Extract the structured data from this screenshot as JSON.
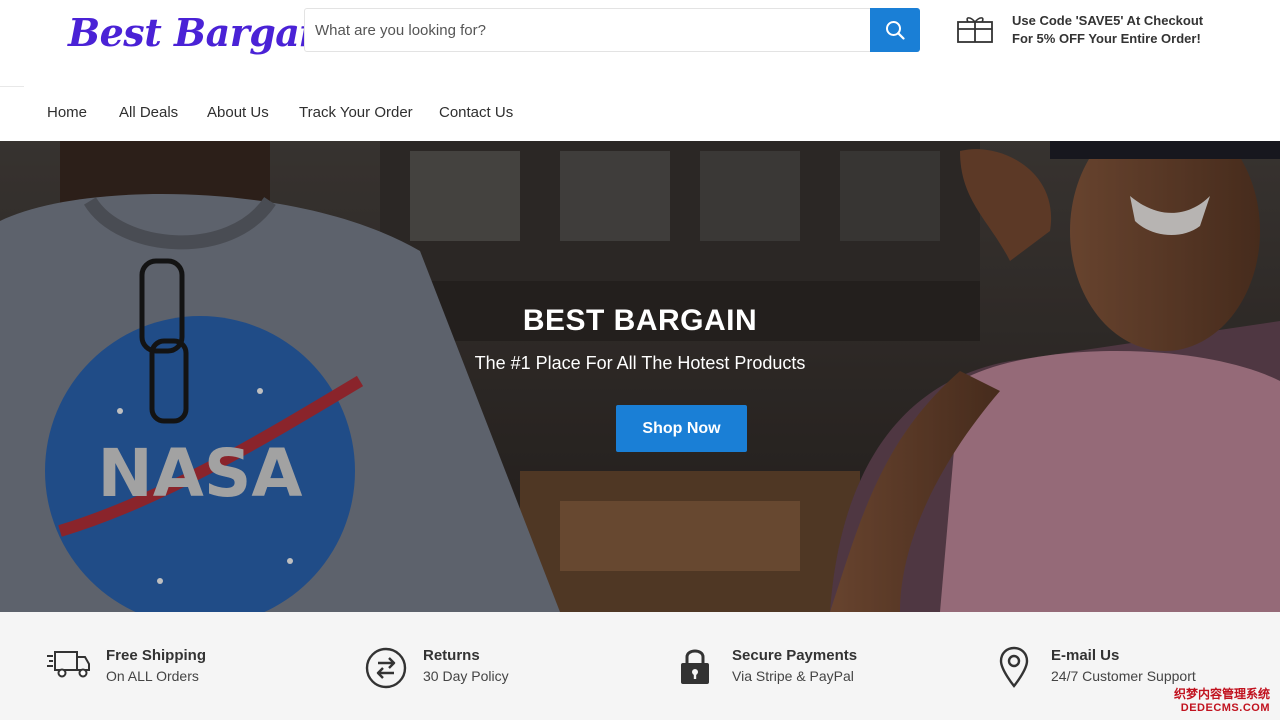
{
  "header": {
    "logo": "Best Bargain",
    "search": {
      "placeholder": "What are you looking for?"
    },
    "promo": {
      "line1": "Use Code 'SAVE5' At Checkout",
      "line2": "For 5% OFF Your Entire Order!"
    }
  },
  "nav": {
    "items": [
      {
        "label": "Home"
      },
      {
        "label": "All Deals"
      },
      {
        "label": "About Us"
      },
      {
        "label": "Track Your Order"
      },
      {
        "label": "Contact Us"
      }
    ]
  },
  "hero": {
    "title": "BEST BARGAIN",
    "subtitle": "The #1 Place For All The Hotest Products",
    "button": "Shop Now"
  },
  "features": [
    {
      "icon": "truck-icon",
      "title": "Free Shipping",
      "subtitle": "On ALL Orders"
    },
    {
      "icon": "returns-icon",
      "title": "Returns",
      "subtitle": "30 Day Policy"
    },
    {
      "icon": "lock-icon",
      "title": "Secure Payments",
      "subtitle": "Via Stripe & PayPal"
    },
    {
      "icon": "map-pin-icon",
      "title": "E-mail Us",
      "subtitle": "24/7 Customer Support"
    }
  ],
  "watermark": {
    "line1": "织梦内容管理系统",
    "line2": "DEDECMS.COM"
  },
  "colors": {
    "accent": "#1a7fd6",
    "logo": "#4a22d6",
    "features_bg": "#f5f5f5"
  }
}
